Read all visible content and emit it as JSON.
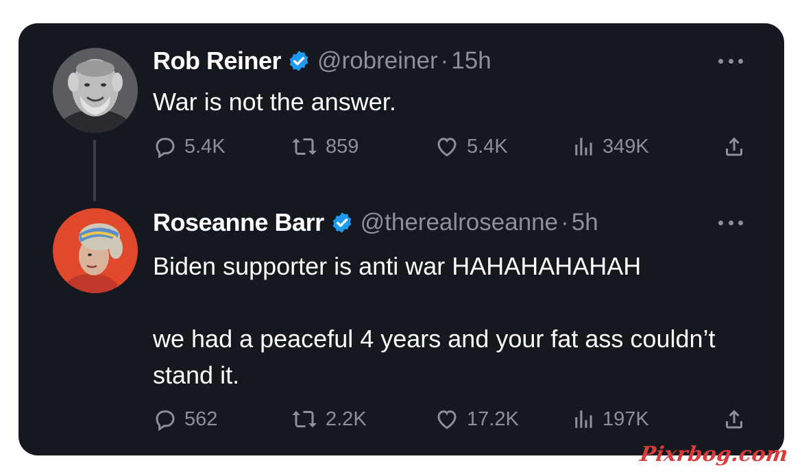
{
  "colors": {
    "card_background": "#15181e",
    "text_primary": "#ffffff",
    "text_secondary": "#8b9199",
    "verified_blue": "#1d9bf0",
    "watermark_red": "#d93a3a"
  },
  "tweets": [
    {
      "name": "Rob Reiner",
      "verified": true,
      "handle": "@robreiner",
      "separator": "·",
      "time": "15h",
      "text": [
        "War is not the answer."
      ],
      "stats": {
        "replies": "5.4K",
        "retweets": "859",
        "likes": "5.4K",
        "views": "349K"
      },
      "avatar_icon": "avatar-photo-grayscale"
    },
    {
      "name": "Roseanne Barr",
      "verified": true,
      "handle": "@therealroseanne",
      "separator": "·",
      "time": "5h",
      "text": [
        "Biden supporter is anti war HAHAHAHAHAH",
        "we had a peaceful 4 years and your fat ass couldn’t stand it."
      ],
      "stats": {
        "replies": "562",
        "retweets": "2.2K",
        "likes": "17.2K",
        "views": "197K"
      },
      "avatar_icon": "avatar-photo-red-background"
    }
  ],
  "icons": {
    "verified": "verified-badge-icon",
    "more": "more-options-icon",
    "reply": "reply-icon",
    "retweet": "retweet-icon",
    "like": "heart-icon",
    "views": "views-bar-chart-icon",
    "share": "share-icon"
  },
  "watermark": "Pixrbog.com"
}
